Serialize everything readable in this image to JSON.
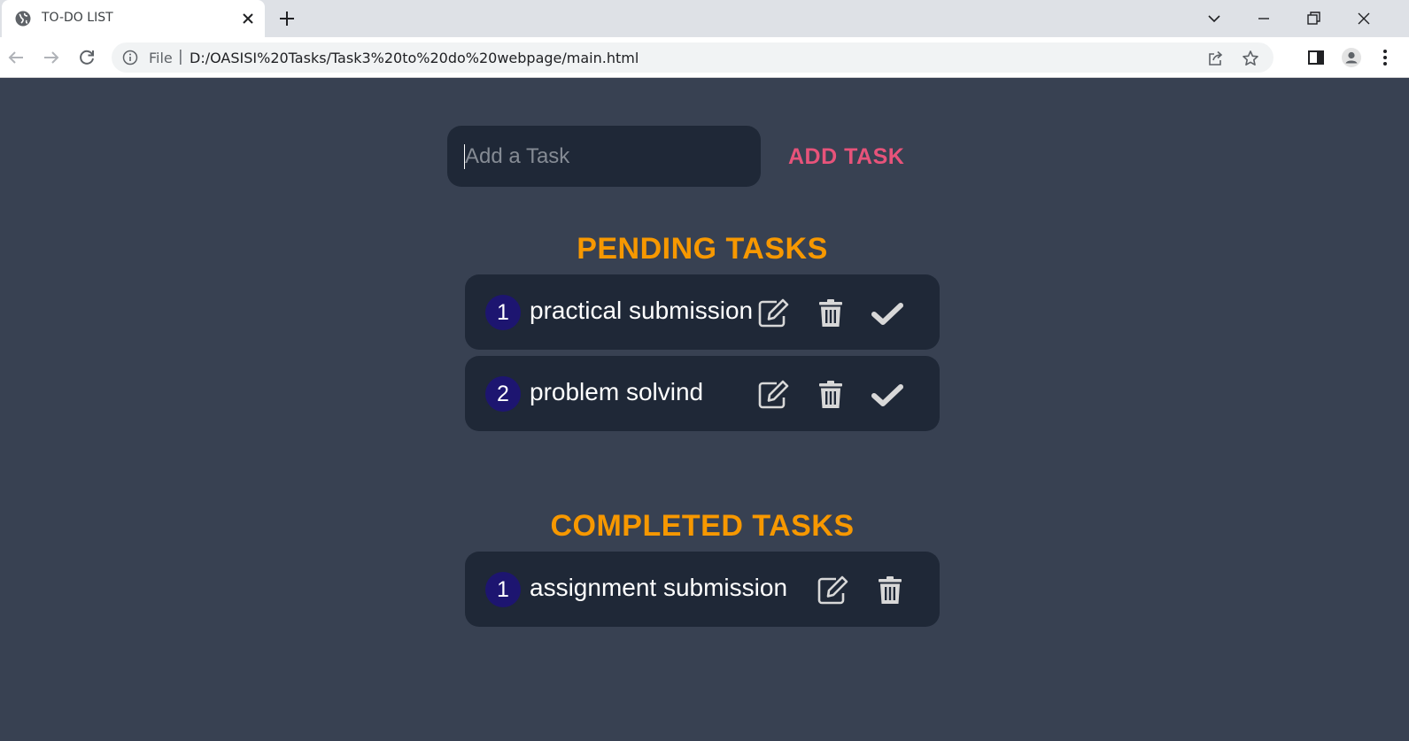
{
  "browser": {
    "tab_title": "TO-DO LIST",
    "url_scheme": "File",
    "url_sep": "|",
    "url": "D:/OASISI%20Tasks/Task3%20to%20do%20webpage/main.html"
  },
  "input": {
    "placeholder": "Add a Task",
    "value": ""
  },
  "add_button_label": "ADD TASK",
  "pending": {
    "title": "PENDING TASKS",
    "tasks": [
      {
        "num": "1",
        "text": "practical submission"
      },
      {
        "num": "2",
        "text": "problem solvind"
      }
    ]
  },
  "completed": {
    "title": "COMPLETED TASKS",
    "tasks": [
      {
        "num": "1",
        "text": "assignment submission"
      }
    ]
  },
  "colors": {
    "background": "#384152",
    "card": "#1f2837",
    "accent_title": "#f79800",
    "add_button": "#e7537a",
    "number_badge": "#1d1570"
  },
  "icons": {
    "edit": "edit-icon",
    "delete": "trash-icon",
    "complete": "check-icon"
  }
}
